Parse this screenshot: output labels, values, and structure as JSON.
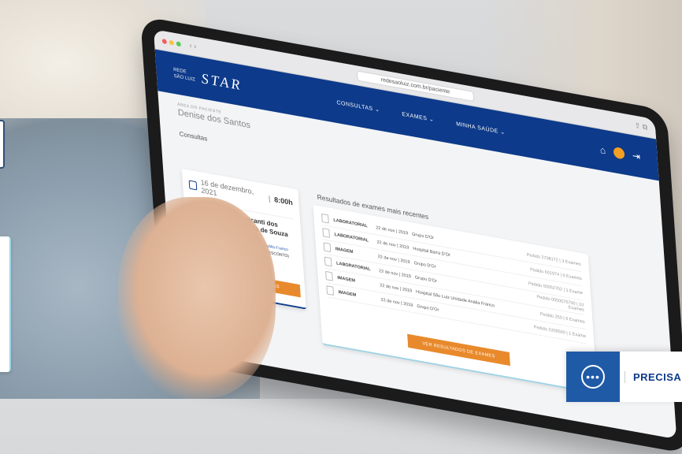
{
  "browser": {
    "url": "redesaoluiz.com.br/paciente"
  },
  "header": {
    "logo_small_line1": "REDE",
    "logo_small_line2": "SÃO LUIZ",
    "logo_brand": "STAR",
    "nav": [
      {
        "label": "CONSULTAS"
      },
      {
        "label": "EXAMES"
      },
      {
        "label": "MINHA SAÚDE"
      }
    ]
  },
  "greeting": {
    "label": "ÁREA DO PACIENTE",
    "name": "Denise dos Santos"
  },
  "appointments": {
    "section_title": "Consultas",
    "date": "16 de dezembro, 2021",
    "time": "8:00h",
    "doctor_name": "Denise Cavalcanti dos Santos Almeida de Souza",
    "specialty": "Cardiologia Clínica",
    "location": "Hospital São Luiz Unidade Anália Franco",
    "insurance": "OPCN LINE (CARTÃO DE DESCONTO)",
    "button_label": "VER TODAS AS CONSULTAS"
  },
  "results": {
    "title": "Resultados de exames mais recentes",
    "rows": [
      {
        "type": "LABORATORIAL",
        "date": "22 de nov | 2019",
        "place": "Grupo D'Or",
        "order": "Pedido 2708172 | 3 Exames"
      },
      {
        "type": "LABORATORIAL",
        "date": "22 de nov | 2019",
        "place": "Hospital Barra D'Or",
        "order": "Pedido 601974 | 6 Exames"
      },
      {
        "type": "IMAGEM",
        "date": "22 de nov | 2019",
        "place": "Grupo D'Or",
        "order": "Pedido 00052762 | 1 Exame"
      },
      {
        "type": "LABORATORIAL",
        "date": "22 de nov | 2019",
        "place": "Grupo D'Or",
        "order": "Pedido 0050076700 | 10 Exames"
      },
      {
        "type": "IMAGEM",
        "date": "22 de nov | 2019",
        "place": "Hospital São Luiz Unidade Anália Franco",
        "order": "Pedido 250 | 6 Exames"
      },
      {
        "type": "IMAGEM",
        "date": "22 de nov | 2019",
        "place": "Grupo D'Or",
        "order": "Pedido 2209500 | 1 Exame"
      }
    ],
    "button_label": "VER RESULTADOS DE EXAMES"
  },
  "help_widget": {
    "label": "PRECISA"
  }
}
